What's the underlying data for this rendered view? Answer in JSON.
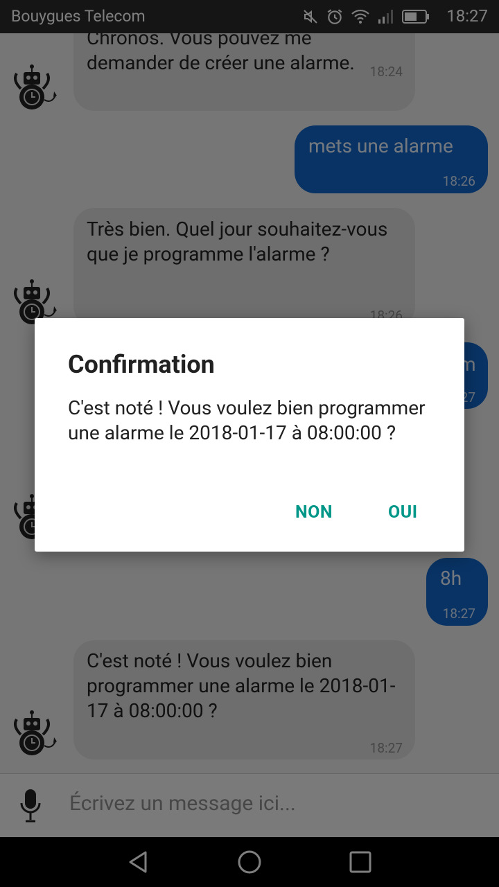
{
  "status_bar": {
    "carrier": "Bouygues Telecom",
    "time": "18:27",
    "icons": [
      "mute-icon",
      "alarm-icon",
      "wifi-icon",
      "signal-icon",
      "battery-icon"
    ]
  },
  "messages": [
    {
      "sender": "bot",
      "text": "Chronos. Vous pouvez me demander de créer une alarme.",
      "time": "18:24"
    },
    {
      "sender": "user",
      "text": "mets une alarme",
      "time": "18:26"
    },
    {
      "sender": "bot",
      "text": "Très bien. Quel jour souhaitez-vous que je programme l'alarme ?",
      "time": "18:26"
    },
    {
      "sender": "user",
      "text": "m",
      "time": "27"
    },
    {
      "sender": "user",
      "text": "8h",
      "time": "18:27"
    },
    {
      "sender": "bot",
      "text": "C'est noté ! Vous voulez bien programmer une alarme le 2018-01-17 à 08:00:00 ?",
      "time": "18:27"
    }
  ],
  "input": {
    "placeholder": "Écrivez un message ici..."
  },
  "dialog": {
    "title": "Confirmation",
    "message": "C'est noté ! Vous voulez bien programmer une alarme le 2018-01-17 à 08:00:00 ?",
    "negative_label": "NON",
    "positive_label": "OUI"
  },
  "colors": {
    "user_bubble": "#1366c9",
    "bot_bubble": "#dcdcdc",
    "dialog_button": "#009688"
  }
}
